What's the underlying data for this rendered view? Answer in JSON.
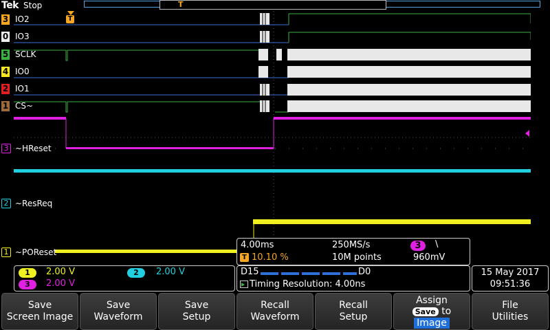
{
  "topbar": {
    "brand": "Tek",
    "status": "Stop",
    "trigger_marker": "T"
  },
  "digital_channels": [
    {
      "tag": "3",
      "name": "IO2",
      "color": "#f5a623"
    },
    {
      "tag": "0",
      "name": "IO3",
      "color": "#eeeeee"
    },
    {
      "tag": "5",
      "name": "SCLK",
      "color": "#3cb043"
    },
    {
      "tag": "4",
      "name": "IO0",
      "color": "#f5e623"
    },
    {
      "tag": "2",
      "name": "IO1",
      "color": "#e02020"
    },
    {
      "tag": "1",
      "name": "CS~",
      "color": "#9c6b3c"
    }
  ],
  "analog_channels": [
    {
      "tag": "3",
      "name": "~HReset",
      "color": "#e020e0"
    },
    {
      "tag": "2",
      "name": "~ResReq",
      "color": "#20d0e0"
    },
    {
      "tag": "1",
      "name": "~POReset",
      "color": "#f0f020"
    }
  ],
  "acquisition": {
    "horizontal_scale": "4.00ms",
    "sample_rate": "250MS/s",
    "trigger_channel": "3",
    "trigger_slope": "\\",
    "trigger_position": "10.10 %",
    "record_length": "10M points",
    "trigger_level": "960mV",
    "trigger_marker": "T"
  },
  "vertical_scales": [
    {
      "channel": "1",
      "value": "2.00 V",
      "color": "#f0f020"
    },
    {
      "channel": "2",
      "value": "2.00 V",
      "color": "#20d0e0"
    },
    {
      "channel": "3",
      "value": "2.00 V",
      "color": "#e020e0"
    }
  ],
  "digital_info": {
    "high": "D15",
    "low": "D0",
    "timing_resolution": "Timing Resolution: 4.00ns"
  },
  "datetime": {
    "date": "15 May 2017",
    "time": "09:51:36"
  },
  "menu": [
    {
      "line1": "Save",
      "line2": "Screen Image"
    },
    {
      "line1": "Save",
      "line2": "Waveform"
    },
    {
      "line1": "Save",
      "line2": "Setup"
    },
    {
      "line1": "Recall",
      "line2": "Waveform"
    },
    {
      "line1": "Recall",
      "line2": "Setup"
    },
    {
      "line1": "Assign",
      "save_badge": "Save",
      "to": "to",
      "highlight": "Image"
    },
    {
      "line1": "File",
      "line2": "Utilities"
    }
  ]
}
